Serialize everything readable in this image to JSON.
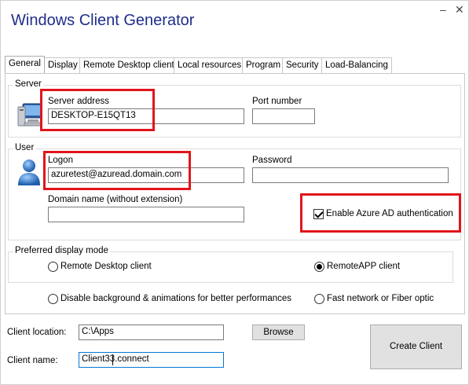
{
  "window": {
    "title": "Windows Client Generator",
    "minimize_glyph": "–",
    "close_glyph": "✕"
  },
  "tabs": [
    {
      "label": "General",
      "active": true
    },
    {
      "label": "Display"
    },
    {
      "label": "Remote Desktop client"
    },
    {
      "label": "Local resources"
    },
    {
      "label": "Program"
    },
    {
      "label": "Security"
    },
    {
      "label": "Load-Balancing"
    }
  ],
  "server": {
    "group_label": "Server",
    "icon": "computer-icon",
    "address_label": "Server address",
    "address_value": "DESKTOP-E15QT13",
    "port_label": "Port number",
    "port_value": ""
  },
  "user": {
    "group_label": "User",
    "icon": "user-icon",
    "logon_label": "Logon",
    "logon_value": "azuretest@azuread.domain.com",
    "password_label": "Password",
    "password_value": "",
    "domain_label": "Domain name (without extension)",
    "domain_value": "",
    "azure_ad_label": "Enable Azure AD authentication",
    "azure_ad_checked": true
  },
  "display_mode": {
    "group_label": "Preferred display mode",
    "option_rdc": "Remote Desktop client",
    "option_remoteapp": "RemoteAPP client",
    "selected": "RemoteAPP client",
    "option_disable_bg": "Disable background & animations for better performances",
    "option_fast_network": "Fast network or Fiber optic"
  },
  "bottom": {
    "client_location_label": "Client location:",
    "client_location_value": "C:\\Apps",
    "browse_label": "Browse",
    "client_name_label": "Client name:",
    "client_name_value": "Client33.connect",
    "create_label": "Create Client"
  },
  "colors": {
    "title": "#1f2d8a",
    "highlight": "#e0161b",
    "focus": "#0078d7"
  }
}
